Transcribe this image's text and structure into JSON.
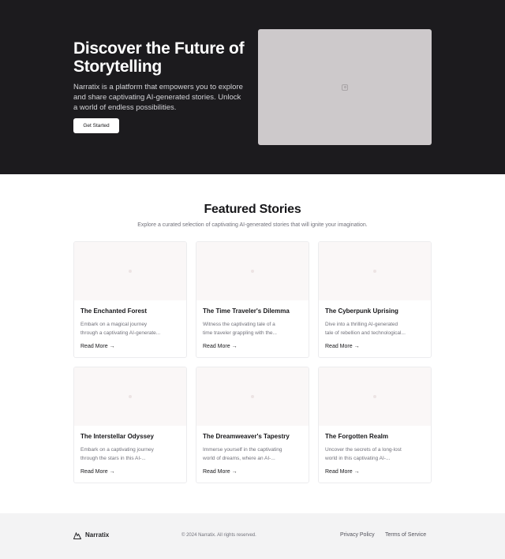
{
  "hero": {
    "title": "Discover the Future of Storytelling",
    "description": "Narratix is a platform that empowers you to explore and share captivating AI-generated stories. Unlock a world of endless possibilities.",
    "button_label": "Get Started"
  },
  "featured": {
    "title": "Featured Stories",
    "subtitle": "Explore a curated selection of captivating AI-generated stories that will ignite your imagination.",
    "cards": [
      {
        "title": "The Enchanted Forest",
        "desc_line1": "Embark on a magical journey",
        "desc_line2": "through a captivating AI-generate...",
        "link": "Read More →"
      },
      {
        "title": "The Time Traveler's Dilemma",
        "desc_line1": "Witness the captivating tale of a",
        "desc_line2": "time traveler grappling with the...",
        "link": "Read More →"
      },
      {
        "title": "The Cyberpunk Uprising",
        "desc_line1": "Dive into a thrilling AI-generated",
        "desc_line2": "tale of rebellion and technological...",
        "link": "Read More →"
      },
      {
        "title": "The Interstellar Odyssey",
        "desc_line1": "Embark on a captivating journey",
        "desc_line2": "through the stars in this AI-...",
        "link": "Read More →"
      },
      {
        "title": "The Dreamweaver's Tapestry",
        "desc_line1": "Immerse yourself in the captivating",
        "desc_line2": "world of dreams, where an AI-...",
        "link": "Read More →"
      },
      {
        "title": "The Forgotten Realm",
        "desc_line1": "Uncover the secrets of a long-lost",
        "desc_line2": "world in this captivating AI-...",
        "link": "Read More →"
      }
    ]
  },
  "footer": {
    "brand": "Narratix",
    "copyright": "© 2024 Narratix. All rights reserved.",
    "privacy": "Privacy Policy",
    "terms": "Terms of Service"
  }
}
